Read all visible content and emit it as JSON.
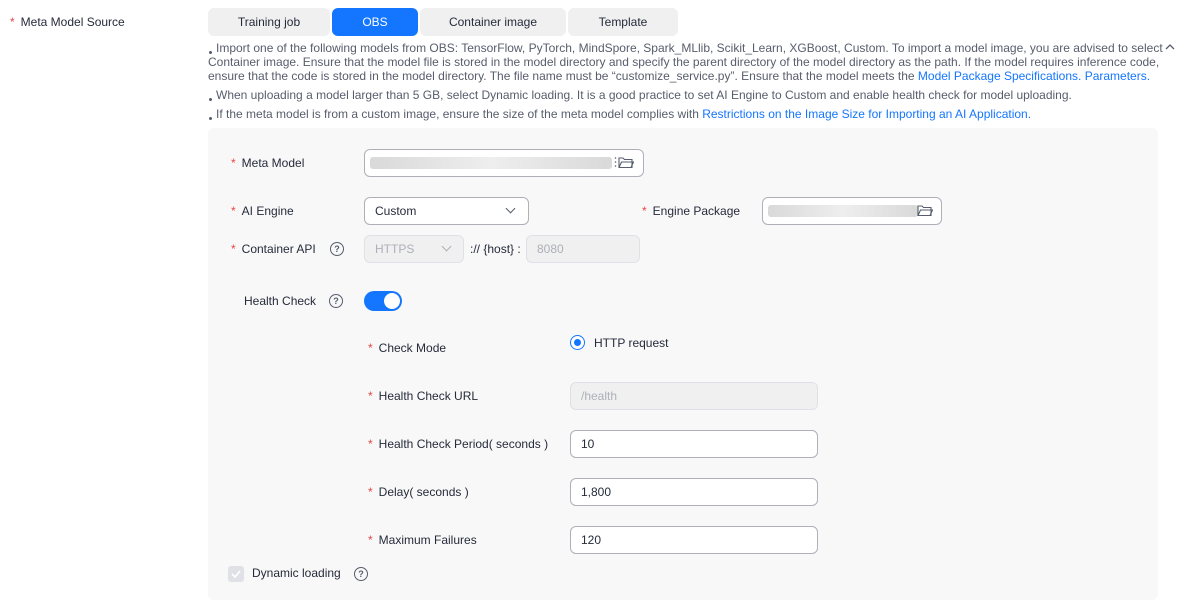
{
  "source": {
    "label": "Meta Model Source",
    "tabs": [
      "Training job",
      "OBS",
      "Container image",
      "Template"
    ],
    "active_tab": "OBS"
  },
  "tips": {
    "t1_text": "Import one of the following models from OBS: TensorFlow, PyTorch, MindSpore, Spark_MLlib, Scikit_Learn, XGBoost, Custom. To import a model image, you are advised to select Container image. Ensure that the model file is stored in the model directory and specify the parent directory of the model directory as the path. If the model requires inference code, ensure that the code is stored in the model directory. The file name must be “customize_service.py”. Ensure that the model meets the ",
    "t1_link1": "Model Package Specifications.",
    "t1_link2": "Parameters.",
    "t2_text": "When uploading a model larger than 5 GB, select Dynamic loading. It is a good practice to set AI Engine to Custom and enable health check for model uploading.",
    "t3_text": "If the meta model is from a custom image, ensure the size of the meta model complies with ",
    "t3_link": "Restrictions on the Image Size for Importing an AI Application."
  },
  "form": {
    "meta_model_label": "Meta Model",
    "ai_engine_label": "AI Engine",
    "ai_engine_value": "Custom",
    "engine_package_label": "Engine Package",
    "container_api_label": "Container API",
    "protocol_value": "HTTPS",
    "host_text": ":// {host} :",
    "port_value": "8080",
    "health_check_label": "Health Check",
    "health_check_enabled": true,
    "check_mode_label": "Check Mode",
    "check_mode_option": "HTTP request",
    "health_url_label": "Health Check URL",
    "health_url_value": "/health",
    "period_label": "Health Check Period( seconds )",
    "period_value": "10",
    "delay_label": "Delay( seconds )",
    "delay_value": "1,800",
    "max_failures_label": "Maximum Failures",
    "max_failures_value": "120",
    "dynamic_loading_label": "Dynamic loading"
  },
  "colors": {
    "accent": "#1476ff",
    "required": "#e54545",
    "panel": "#f8f8f8"
  },
  "icons": [
    "folder-icon",
    "chevron-down-icon",
    "help-icon",
    "chevron-up-icon",
    "check-icon"
  ]
}
